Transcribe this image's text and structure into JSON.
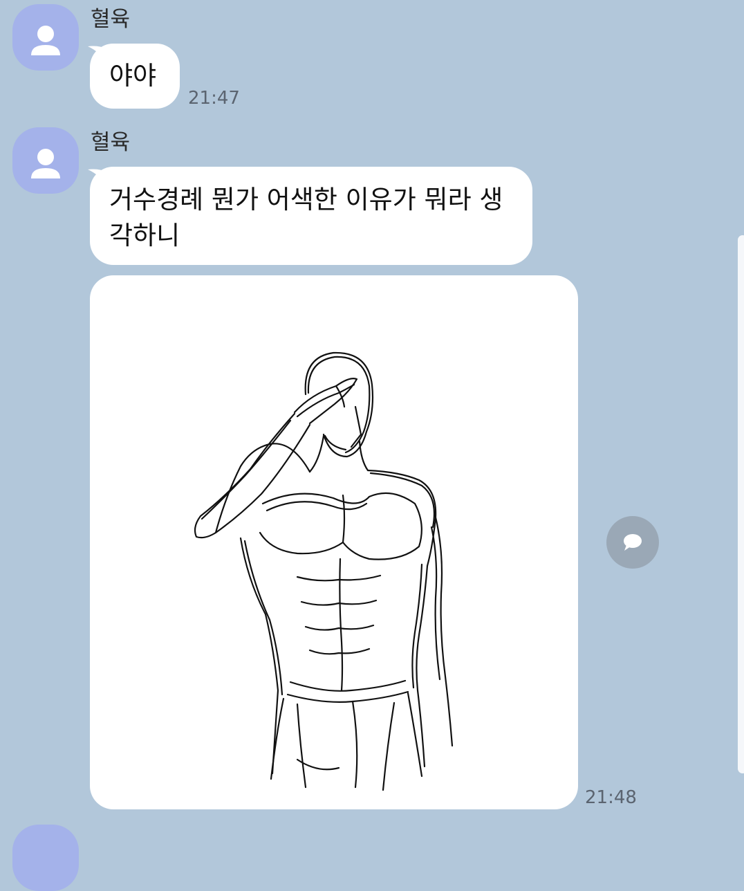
{
  "messages": [
    {
      "sender": "혈육",
      "text": "야야",
      "time": "21:47"
    },
    {
      "sender": "혈육",
      "text": "거수경례 뭔가 어색한 이유가 뭐라 생각하니",
      "time": "21:48"
    }
  ],
  "attachment": {
    "icon": "salute-sketch-image",
    "share_icon": "chat-bubble-icon"
  },
  "colors": {
    "background": "#b2c7da",
    "avatar": "#a4b2ea",
    "bubble": "#ffffff",
    "share_button": "#9aa8b6"
  }
}
